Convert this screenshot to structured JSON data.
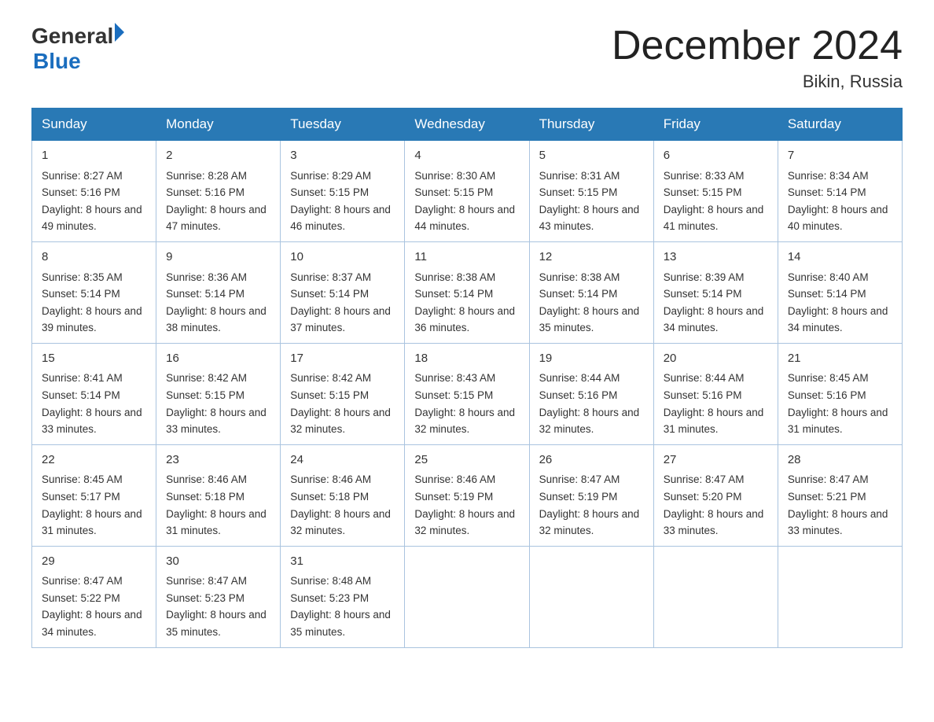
{
  "logo": {
    "line1": "General",
    "line2": "Blue"
  },
  "title": {
    "month_year": "December 2024",
    "location": "Bikin, Russia"
  },
  "headers": [
    "Sunday",
    "Monday",
    "Tuesday",
    "Wednesday",
    "Thursday",
    "Friday",
    "Saturday"
  ],
  "weeks": [
    [
      {
        "day": "1",
        "sunrise": "8:27 AM",
        "sunset": "5:16 PM",
        "daylight": "8 hours and 49 minutes."
      },
      {
        "day": "2",
        "sunrise": "8:28 AM",
        "sunset": "5:16 PM",
        "daylight": "8 hours and 47 minutes."
      },
      {
        "day": "3",
        "sunrise": "8:29 AM",
        "sunset": "5:15 PM",
        "daylight": "8 hours and 46 minutes."
      },
      {
        "day": "4",
        "sunrise": "8:30 AM",
        "sunset": "5:15 PM",
        "daylight": "8 hours and 44 minutes."
      },
      {
        "day": "5",
        "sunrise": "8:31 AM",
        "sunset": "5:15 PM",
        "daylight": "8 hours and 43 minutes."
      },
      {
        "day": "6",
        "sunrise": "8:33 AM",
        "sunset": "5:15 PM",
        "daylight": "8 hours and 41 minutes."
      },
      {
        "day": "7",
        "sunrise": "8:34 AM",
        "sunset": "5:14 PM",
        "daylight": "8 hours and 40 minutes."
      }
    ],
    [
      {
        "day": "8",
        "sunrise": "8:35 AM",
        "sunset": "5:14 PM",
        "daylight": "8 hours and 39 minutes."
      },
      {
        "day": "9",
        "sunrise": "8:36 AM",
        "sunset": "5:14 PM",
        "daylight": "8 hours and 38 minutes."
      },
      {
        "day": "10",
        "sunrise": "8:37 AM",
        "sunset": "5:14 PM",
        "daylight": "8 hours and 37 minutes."
      },
      {
        "day": "11",
        "sunrise": "8:38 AM",
        "sunset": "5:14 PM",
        "daylight": "8 hours and 36 minutes."
      },
      {
        "day": "12",
        "sunrise": "8:38 AM",
        "sunset": "5:14 PM",
        "daylight": "8 hours and 35 minutes."
      },
      {
        "day": "13",
        "sunrise": "8:39 AM",
        "sunset": "5:14 PM",
        "daylight": "8 hours and 34 minutes."
      },
      {
        "day": "14",
        "sunrise": "8:40 AM",
        "sunset": "5:14 PM",
        "daylight": "8 hours and 34 minutes."
      }
    ],
    [
      {
        "day": "15",
        "sunrise": "8:41 AM",
        "sunset": "5:14 PM",
        "daylight": "8 hours and 33 minutes."
      },
      {
        "day": "16",
        "sunrise": "8:42 AM",
        "sunset": "5:15 PM",
        "daylight": "8 hours and 33 minutes."
      },
      {
        "day": "17",
        "sunrise": "8:42 AM",
        "sunset": "5:15 PM",
        "daylight": "8 hours and 32 minutes."
      },
      {
        "day": "18",
        "sunrise": "8:43 AM",
        "sunset": "5:15 PM",
        "daylight": "8 hours and 32 minutes."
      },
      {
        "day": "19",
        "sunrise": "8:44 AM",
        "sunset": "5:16 PM",
        "daylight": "8 hours and 32 minutes."
      },
      {
        "day": "20",
        "sunrise": "8:44 AM",
        "sunset": "5:16 PM",
        "daylight": "8 hours and 31 minutes."
      },
      {
        "day": "21",
        "sunrise": "8:45 AM",
        "sunset": "5:16 PM",
        "daylight": "8 hours and 31 minutes."
      }
    ],
    [
      {
        "day": "22",
        "sunrise": "8:45 AM",
        "sunset": "5:17 PM",
        "daylight": "8 hours and 31 minutes."
      },
      {
        "day": "23",
        "sunrise": "8:46 AM",
        "sunset": "5:18 PM",
        "daylight": "8 hours and 31 minutes."
      },
      {
        "day": "24",
        "sunrise": "8:46 AM",
        "sunset": "5:18 PM",
        "daylight": "8 hours and 32 minutes."
      },
      {
        "day": "25",
        "sunrise": "8:46 AM",
        "sunset": "5:19 PM",
        "daylight": "8 hours and 32 minutes."
      },
      {
        "day": "26",
        "sunrise": "8:47 AM",
        "sunset": "5:19 PM",
        "daylight": "8 hours and 32 minutes."
      },
      {
        "day": "27",
        "sunrise": "8:47 AM",
        "sunset": "5:20 PM",
        "daylight": "8 hours and 33 minutes."
      },
      {
        "day": "28",
        "sunrise": "8:47 AM",
        "sunset": "5:21 PM",
        "daylight": "8 hours and 33 minutes."
      }
    ],
    [
      {
        "day": "29",
        "sunrise": "8:47 AM",
        "sunset": "5:22 PM",
        "daylight": "8 hours and 34 minutes."
      },
      {
        "day": "30",
        "sunrise": "8:47 AM",
        "sunset": "5:23 PM",
        "daylight": "8 hours and 35 minutes."
      },
      {
        "day": "31",
        "sunrise": "8:48 AM",
        "sunset": "5:23 PM",
        "daylight": "8 hours and 35 minutes."
      },
      null,
      null,
      null,
      null
    ]
  ],
  "labels": {
    "sunrise": "Sunrise:",
    "sunset": "Sunset:",
    "daylight": "Daylight:"
  }
}
